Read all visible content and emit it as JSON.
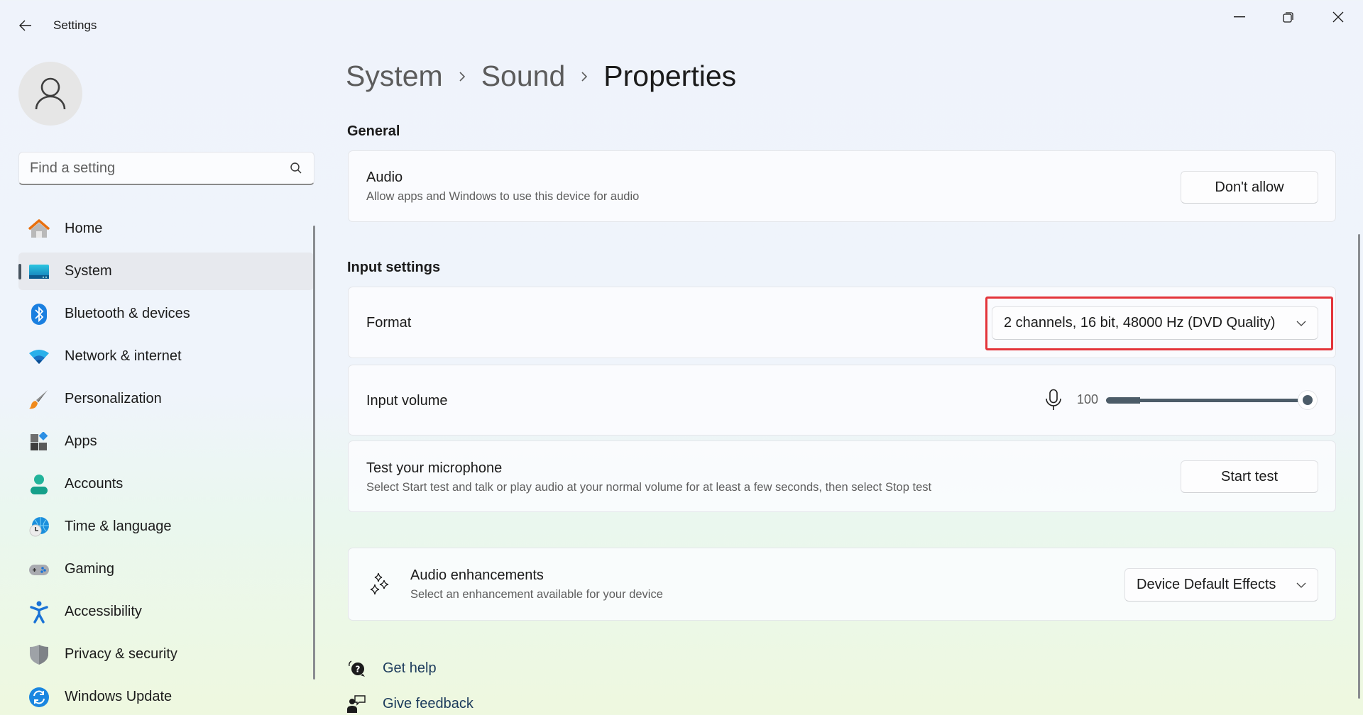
{
  "window": {
    "title": "Settings",
    "controls": {
      "minimize": "minimize",
      "maximize": "restore",
      "close": "close"
    }
  },
  "sidebar": {
    "search": {
      "placeholder": "Find a setting",
      "value": ""
    },
    "items": [
      {
        "label": "Home",
        "icon": "home-icon",
        "selected": false
      },
      {
        "label": "System",
        "icon": "system-icon",
        "selected": true
      },
      {
        "label": "Bluetooth & devices",
        "icon": "bluetooth-icon",
        "selected": false
      },
      {
        "label": "Network & internet",
        "icon": "wifi-icon",
        "selected": false
      },
      {
        "label": "Personalization",
        "icon": "paintbrush-icon",
        "selected": false
      },
      {
        "label": "Apps",
        "icon": "apps-icon",
        "selected": false
      },
      {
        "label": "Accounts",
        "icon": "account-icon",
        "selected": false
      },
      {
        "label": "Time & language",
        "icon": "time-language-icon",
        "selected": false
      },
      {
        "label": "Gaming",
        "icon": "gamepad-icon",
        "selected": false
      },
      {
        "label": "Accessibility",
        "icon": "accessibility-icon",
        "selected": false
      },
      {
        "label": "Privacy & security",
        "icon": "shield-icon",
        "selected": false
      },
      {
        "label": "Windows Update",
        "icon": "update-icon",
        "selected": false
      }
    ]
  },
  "breadcrumb": [
    "System",
    "Sound",
    "Properties"
  ],
  "general": {
    "section_title": "General",
    "audio": {
      "title": "Audio",
      "subtitle": "Allow apps and Windows to use this device for audio",
      "button_label": "Don't allow"
    }
  },
  "input_settings": {
    "section_title": "Input settings",
    "format": {
      "title": "Format",
      "selected": "2 channels, 16 bit, 48000 Hz (DVD Quality)"
    },
    "input_volume": {
      "title": "Input volume",
      "value": 100,
      "value_label": "100"
    },
    "test_microphone": {
      "title": "Test your microphone",
      "subtitle": "Select Start test and talk or play audio at your normal volume for at least a few seconds, then select Stop test",
      "button_label": "Start test"
    }
  },
  "audio_enhancements": {
    "title": "Audio enhancements",
    "subtitle": "Select an enhancement available for your device",
    "selected": "Device Default Effects"
  },
  "footer": {
    "get_help": "Get help",
    "give_feedback": "Give feedback"
  },
  "colors": {
    "accent": "#4c5c68",
    "highlight": "#e3343a"
  }
}
